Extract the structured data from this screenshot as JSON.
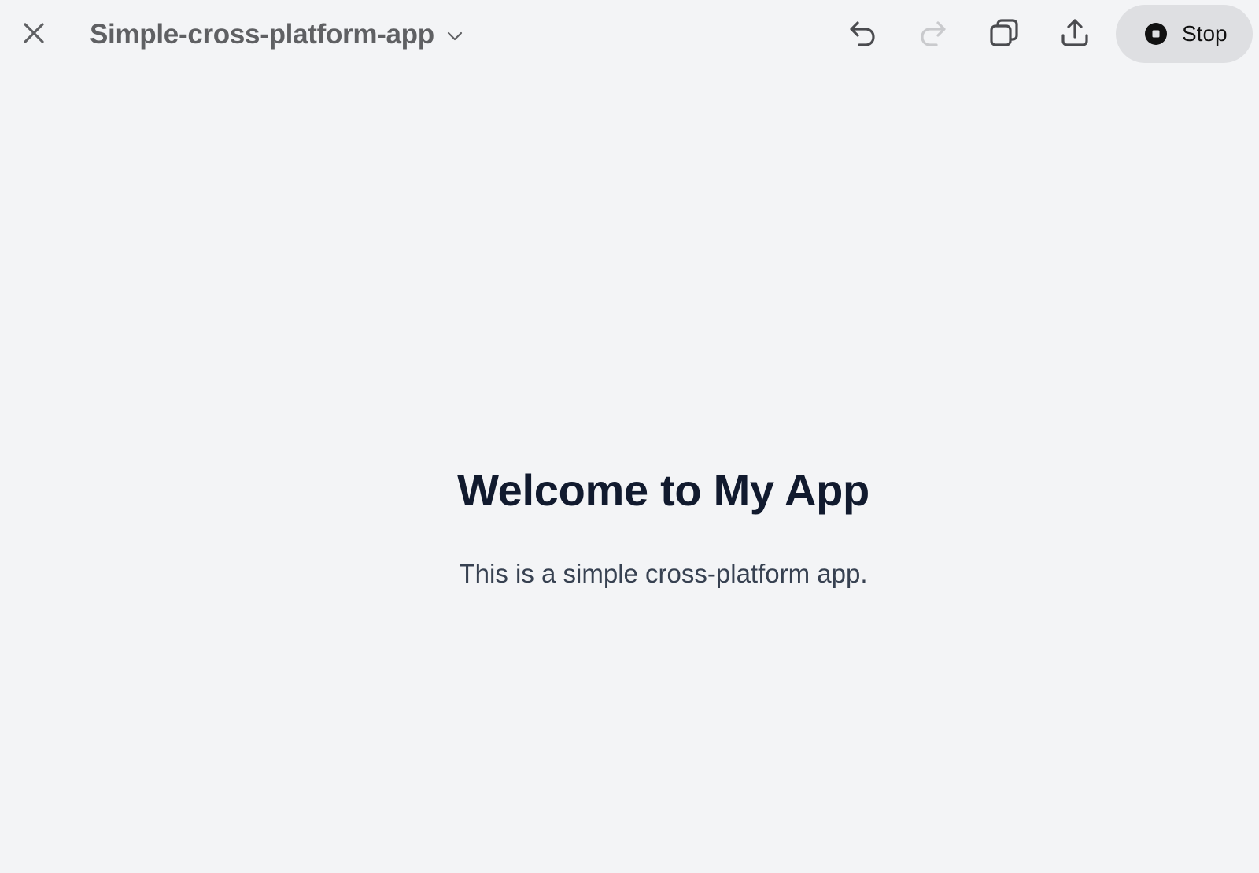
{
  "header": {
    "project_title": "Simple-cross-platform-app",
    "stop_label": "Stop"
  },
  "icons": {
    "close": "close-icon",
    "dropdown": "chevron-down-icon",
    "undo": "undo-icon",
    "redo": "redo-icon",
    "duplicate": "duplicate-icon",
    "share": "share-icon",
    "stop": "stop-icon"
  },
  "main": {
    "title": "Welcome to My App",
    "subtitle": "This is a simple cross-platform app."
  },
  "colors": {
    "background": "#f3f4f6",
    "title": "#111a2e",
    "subtitle": "#374151",
    "header_text": "#5f6063",
    "stop_button": "#dedfe2",
    "disabled_icon": "#c9cacd"
  }
}
